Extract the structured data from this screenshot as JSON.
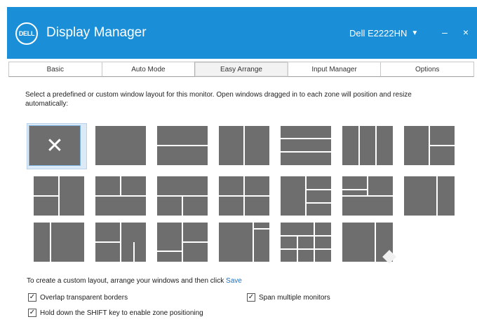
{
  "window": {
    "logo_text": "DELL",
    "title": "Display Manager",
    "monitor": "Dell E2222HN",
    "minimize": "–",
    "close": "×"
  },
  "tabs": [
    {
      "label": "Basic"
    },
    {
      "label": "Auto Mode"
    },
    {
      "label": "Easy Arrange",
      "active": true
    },
    {
      "label": "Input Manager"
    },
    {
      "label": "Options"
    }
  ],
  "instructions": "Select a predefined or custom window layout for this monitor. Open windows dragged in to each zone will position and resize automatically:",
  "layouts_total": 19,
  "selected_layout": 1,
  "next_arrow": ">",
  "custom_hint": {
    "text": "To create a custom layout, arrange your windows and then click ",
    "link": "Save"
  },
  "checkboxes": {
    "overlap": {
      "label": "Overlap transparent borders",
      "checked": true
    },
    "span": {
      "label": "Span multiple monitors",
      "checked": true
    },
    "shift": {
      "label": "Hold down the SHIFT key to enable zone positioning",
      "checked": true
    }
  },
  "icons": [
    "dell-logo",
    "chevron-down",
    "close",
    "next-arrow",
    "checkbox"
  ],
  "colors": {
    "accent": "#1a8fd8",
    "tile": "#6e6e6e",
    "selected_bg": "#dceaf7",
    "link": "#1a6fc0"
  }
}
